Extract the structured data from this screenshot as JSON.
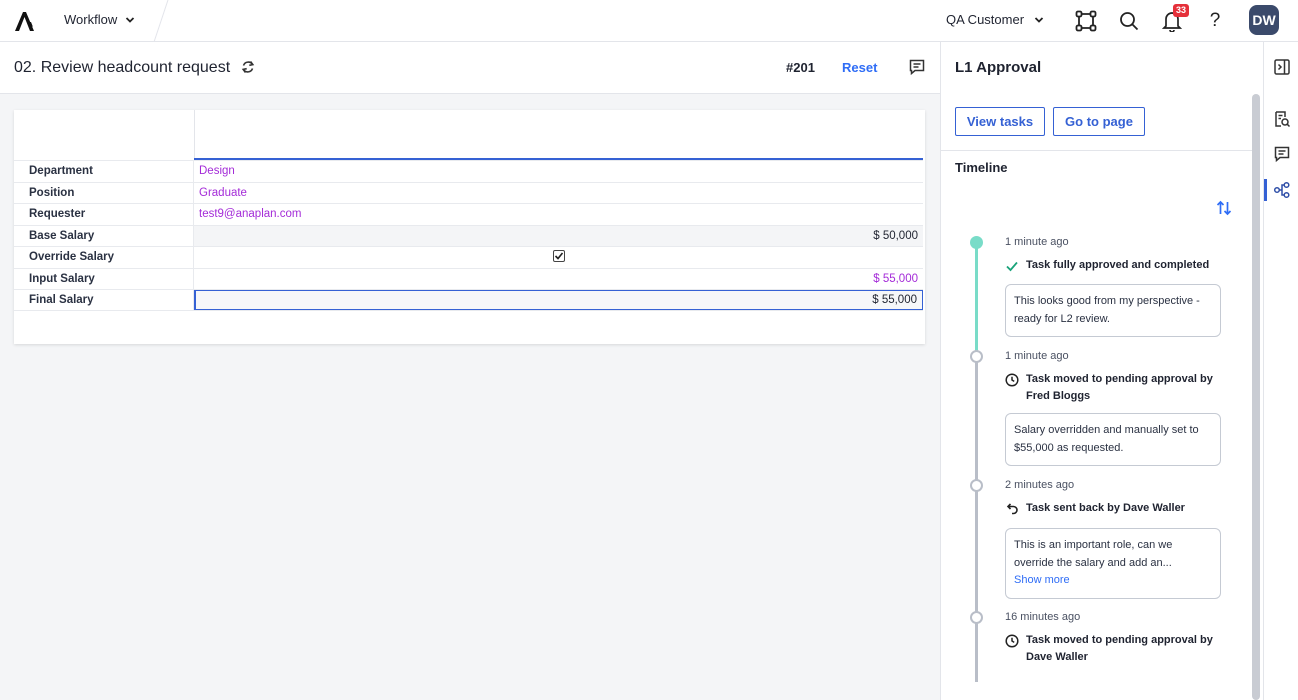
{
  "topbar": {
    "app_menu_label": "Workflow",
    "tenant_label": "QA Customer",
    "notification_count": "33",
    "help_label": "?",
    "avatar_initials": "DW"
  },
  "page": {
    "title": "02. Review headcount request",
    "task_number": "#201",
    "reset_label": "Reset"
  },
  "grid": {
    "rows": [
      {
        "label": "Department",
        "value": "Design"
      },
      {
        "label": "Position",
        "value": "Graduate"
      },
      {
        "label": "Requester",
        "value": "test9@anaplan.com"
      },
      {
        "label": "Base Salary",
        "value": "$ 50,000"
      },
      {
        "label": "Override Salary",
        "value": ""
      },
      {
        "label": "Input Salary",
        "value": "$ 55,000"
      },
      {
        "label": "Final Salary",
        "value": "$ 55,000"
      }
    ]
  },
  "panel": {
    "title": "L1 Approval",
    "view_tasks_label": "View tasks",
    "go_to_page_label": "Go to page",
    "timeline_label": "Timeline",
    "events": [
      {
        "time": "1 minute ago",
        "event": "Task fully approved and completed",
        "icon": "check-icon",
        "note": "This looks good from my perspective - ready for L2 review."
      },
      {
        "time": "1 minute ago",
        "event": "Task moved to pending approval by Fred Bloggs",
        "icon": "clock-icon",
        "note": "Salary overridden and manually set to $55,000 as requested."
      },
      {
        "time": "2 minutes ago",
        "event": "Task sent back by Dave Waller",
        "icon": "undo-icon",
        "note": "This is an important role, can we override the salary and add an...",
        "show_more": "Show more"
      },
      {
        "time": "16 minutes ago",
        "event": "Task moved to pending approval by Dave Waller",
        "icon": "clock-icon"
      }
    ]
  },
  "colors": {
    "accent": "#3561d4",
    "link": "#2f6df6",
    "value_purple": "#a42bd8",
    "timeline_active": "#79dcc8",
    "badge_red": "#e5303a"
  }
}
